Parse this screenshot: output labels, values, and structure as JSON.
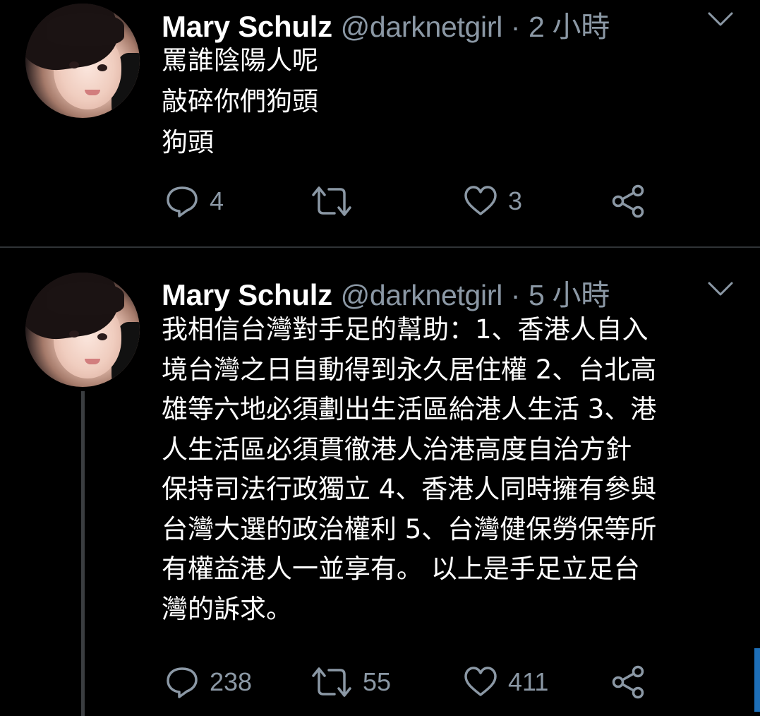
{
  "tweets": [
    {
      "author": {
        "name": "Mary Schulz",
        "handle": "@darknetgirl"
      },
      "time": "2 小時",
      "text_lines": [
        "罵誰陰陽人呢",
        "敲碎你們狗頭",
        "狗頭"
      ],
      "stats": {
        "replies": "4",
        "retweets": "",
        "likes": "3"
      }
    },
    {
      "author": {
        "name": "Mary Schulz",
        "handle": "@darknetgirl"
      },
      "time": "5 小時",
      "text_lines": [
        "我相信台灣對手足的幫助：1、香港人自入",
        "境台灣之日自動得到永久居住權 2、台北高",
        "雄等六地必須劃出生活區給港人生活 3、港",
        "人生活區必須貫徹港人治港高度自治方針",
        "保持司法行政獨立 4、香港人同時擁有參與",
        "台灣大選的政治權利 5、台灣健保勞保等所",
        "有權益港人一並享有。 以上是手足立足台",
        "灣的訴求。"
      ],
      "stats": {
        "replies": "238",
        "retweets": "55",
        "likes": "411"
      }
    }
  ],
  "icons": {
    "reply": "reply-icon",
    "retweet": "retweet-icon",
    "like": "heart-icon",
    "share": "share-icon",
    "more": "chevron-down-icon"
  },
  "colors": {
    "background": "#000000",
    "text": "#ffffff",
    "secondary": "#8b98a5",
    "divider": "#2f3336",
    "thread_line": "#3a3d40"
  }
}
